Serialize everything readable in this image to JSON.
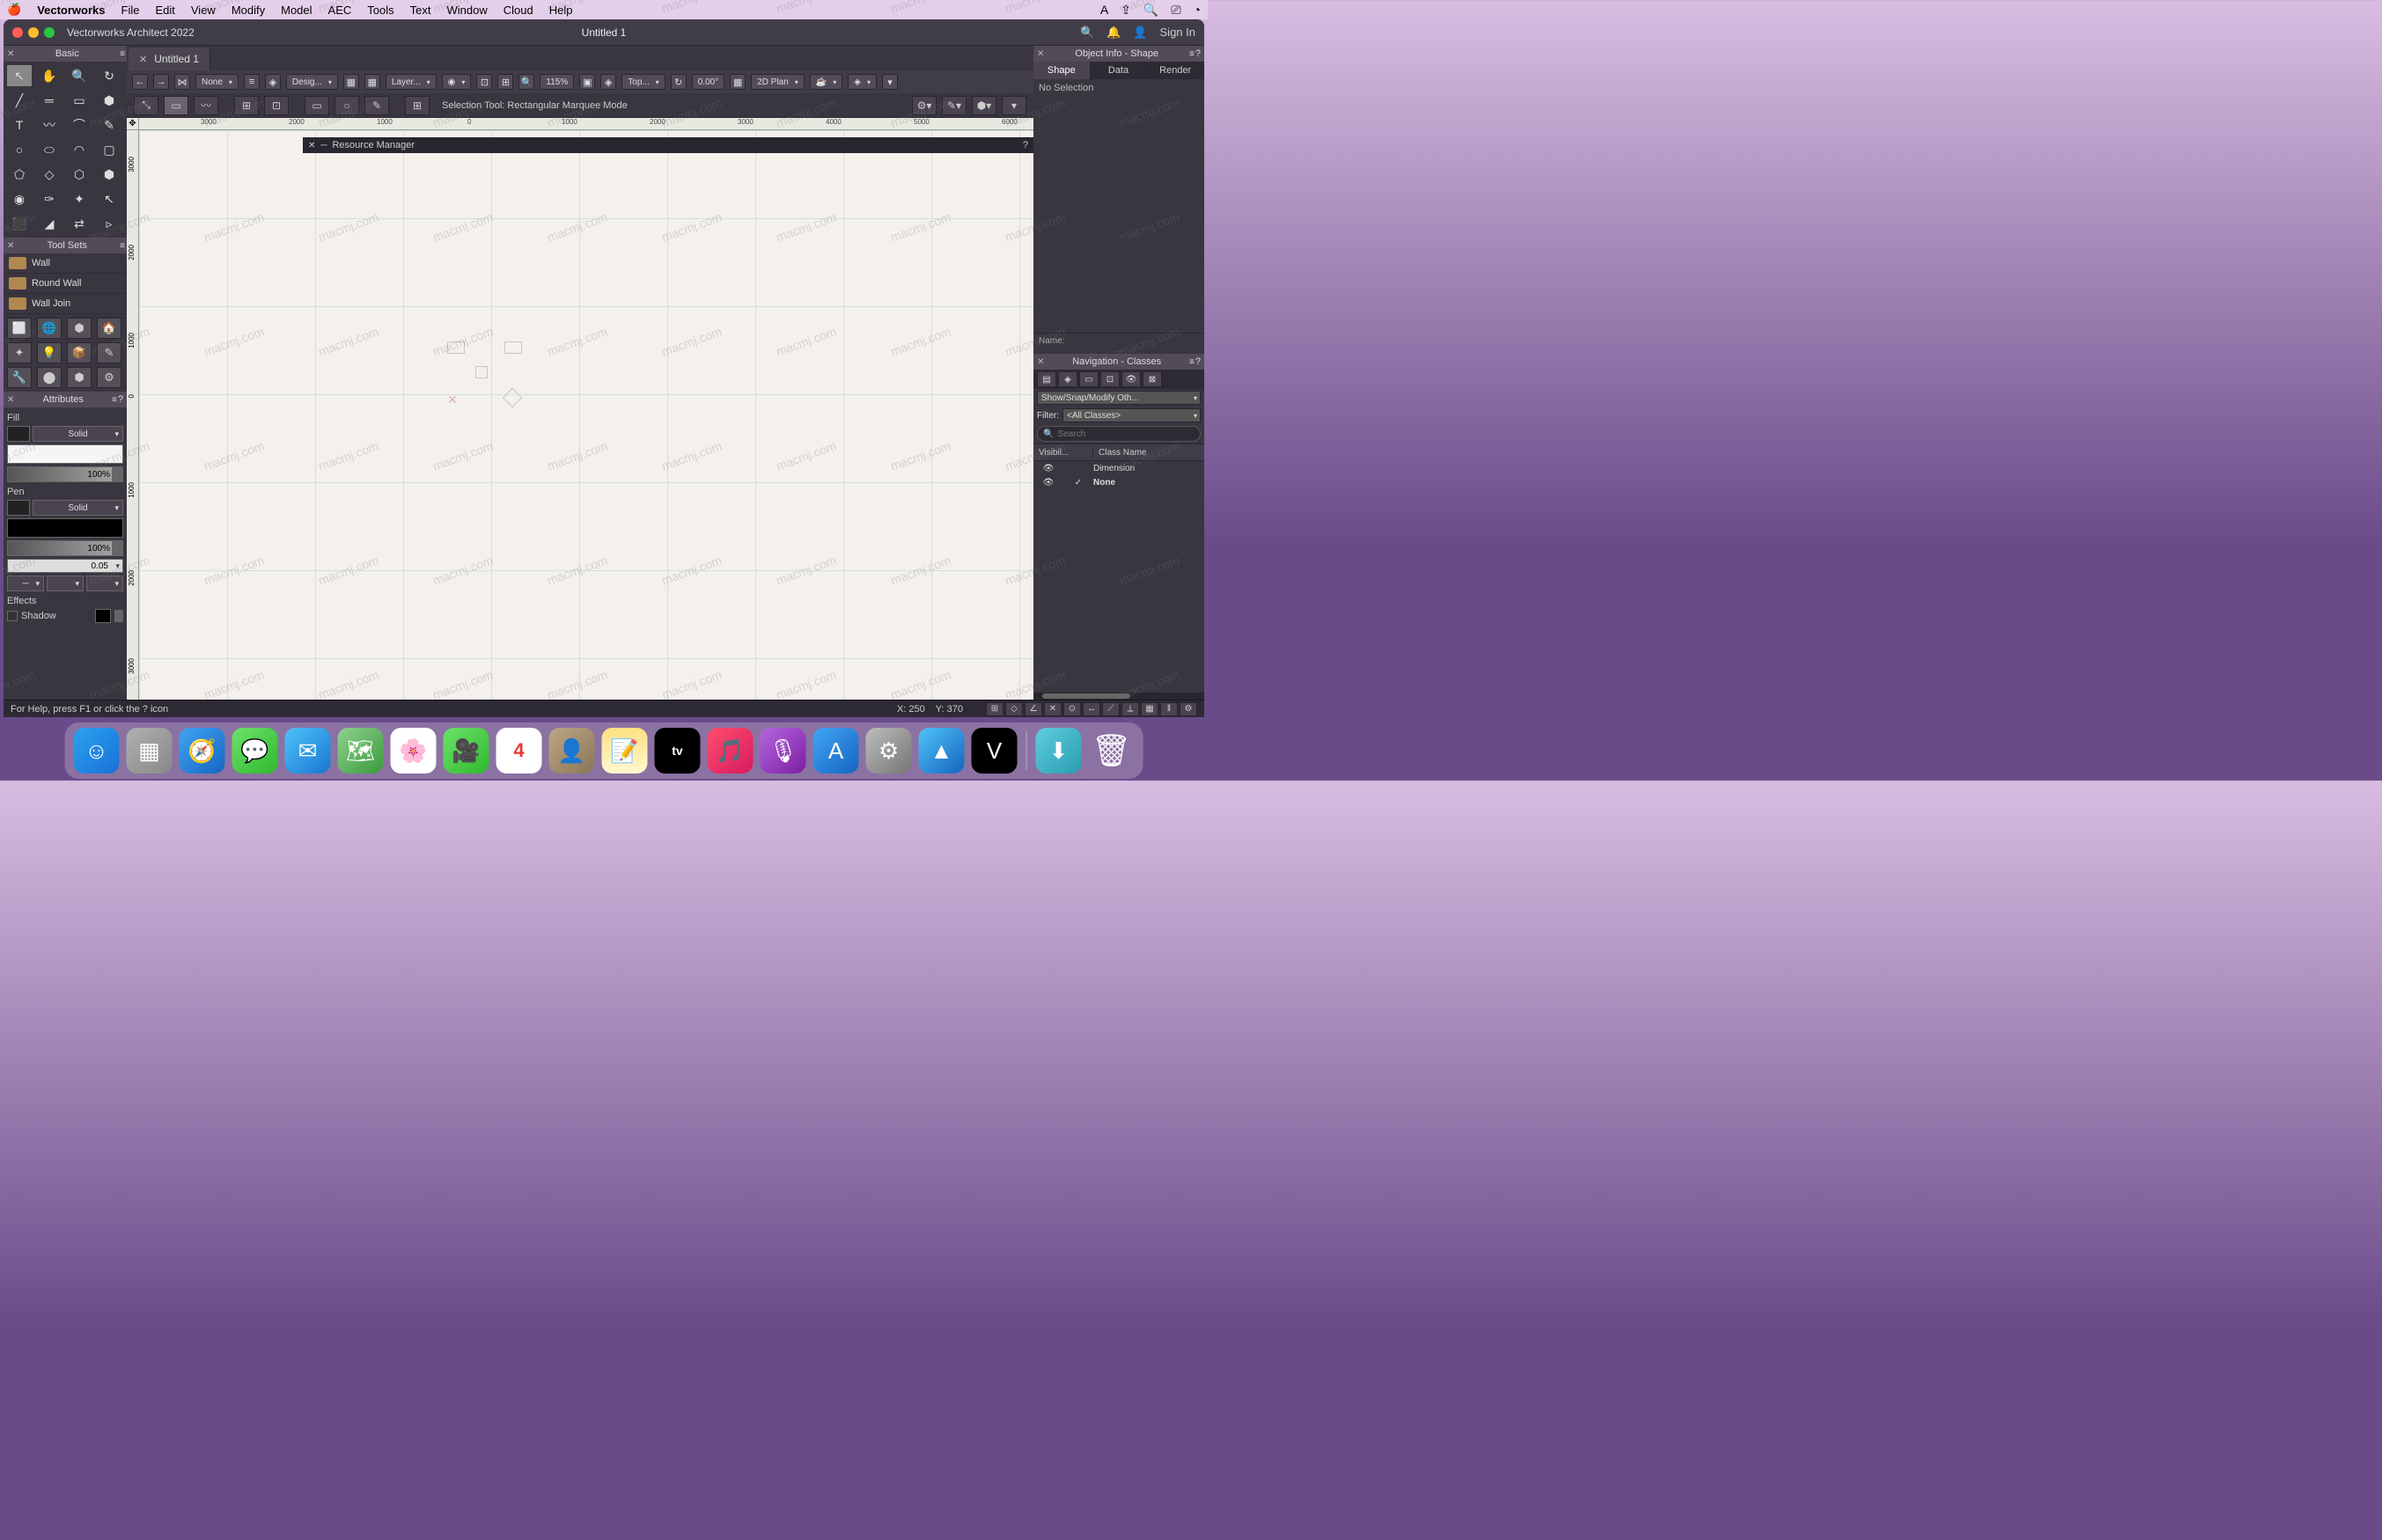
{
  "menubar": {
    "app": "Vectorworks",
    "items": [
      "File",
      "Edit",
      "View",
      "Modify",
      "Model",
      "AEC",
      "Tools",
      "Text",
      "Window",
      "Cloud",
      "Help"
    ]
  },
  "titlebar": {
    "app_title": "Vectorworks Architect 2022",
    "doc_title": "Untitled 1",
    "signin": "Sign In"
  },
  "tabs": {
    "doc_tab": "Untitled 1"
  },
  "viewbar": {
    "class_sel": "None",
    "layer_sel": "Desig...",
    "workplane": "Layer...",
    "zoom": "115%",
    "view": "Top...",
    "rotation": "0.00°",
    "render": "2D Plan"
  },
  "modebar": {
    "hint": "Selection Tool: Rectangular Marquee Mode"
  },
  "palettes": {
    "basic": {
      "title": "Basic"
    },
    "toolsets": {
      "title": "Tool Sets",
      "items": [
        "Wall",
        "Round Wall",
        "Wall Join"
      ]
    },
    "attributes": {
      "title": "Attributes",
      "fill_label": "Fill",
      "fill_type": "Solid",
      "fill_opacity": "100%",
      "pen_label": "Pen",
      "pen_type": "Solid",
      "pen_opacity": "100%",
      "line_weight": "0.05",
      "effects_label": "Effects",
      "shadow_label": "Shadow"
    }
  },
  "object_info": {
    "title": "Object Info - Shape",
    "tabs": [
      "Shape",
      "Data",
      "Render"
    ],
    "no_selection": "No Selection",
    "name_label": "Name:"
  },
  "navigation": {
    "title": "Navigation - Classes",
    "show_snap": "Show/Snap/Modify Oth...",
    "filter_label": "Filter:",
    "filter_value": "<All Classes>",
    "search_placeholder": "Search",
    "columns": {
      "visibility": "Visibil...",
      "class_name": "Class Name"
    },
    "rows": [
      {
        "visible": "👁",
        "active": "",
        "name": "Dimension"
      },
      {
        "visible": "👁",
        "active": "✓",
        "name": "None"
      }
    ]
  },
  "resource_manager": {
    "title": "Resource Manager"
  },
  "ruler": {
    "h_ticks": [
      "3000",
      "2000",
      "1000",
      "0",
      "1000",
      "2000",
      "3000",
      "4000",
      "5000",
      "6000"
    ],
    "v_ticks": [
      "3000",
      "2000",
      "1000",
      "0",
      "1000",
      "2000",
      "3000"
    ]
  },
  "statusbar": {
    "help": "For Help, press F1 or click the ? icon",
    "x_label": "X:",
    "x_val": "250",
    "y_label": "Y:",
    "y_val": "370"
  },
  "dock": {
    "apps": [
      {
        "name": "finder",
        "bg": "linear-gradient(135deg,#2aa3ef,#1a6fd8)",
        "glyph": "☺"
      },
      {
        "name": "launchpad",
        "bg": "linear-gradient(135deg,#b0b0b0,#888)",
        "glyph": "▦"
      },
      {
        "name": "safari",
        "bg": "linear-gradient(135deg,#42a5f5,#1565c0)",
        "glyph": "🧭"
      },
      {
        "name": "messages",
        "bg": "linear-gradient(135deg,#6ee36a,#2eb82e)",
        "glyph": "💬"
      },
      {
        "name": "mail",
        "bg": "linear-gradient(135deg,#4fc3f7,#1976d2)",
        "glyph": "✉"
      },
      {
        "name": "maps",
        "bg": "linear-gradient(135deg,#8fd28f,#3a9a3a)",
        "glyph": "🗺"
      },
      {
        "name": "photos",
        "bg": "#fff",
        "glyph": "🌸"
      },
      {
        "name": "facetime",
        "bg": "linear-gradient(135deg,#6ee36a,#2eb82e)",
        "glyph": "🎥"
      },
      {
        "name": "calendar",
        "bg": "#fff",
        "glyph": "4"
      },
      {
        "name": "contacts",
        "bg": "linear-gradient(135deg,#bca784,#8a7658)",
        "glyph": "👤"
      },
      {
        "name": "notes",
        "bg": "linear-gradient(180deg,#ffe082,#fff8d0)",
        "glyph": "📝"
      },
      {
        "name": "appletv",
        "bg": "#000",
        "glyph": "tv"
      },
      {
        "name": "music",
        "bg": "linear-gradient(135deg,#ff4d6d,#d81b60)",
        "glyph": "🎵"
      },
      {
        "name": "podcasts",
        "bg": "linear-gradient(135deg,#b565e0,#7b1fa2)",
        "glyph": "🎙"
      },
      {
        "name": "appstore",
        "bg": "linear-gradient(135deg,#42a5f5,#1565c0)",
        "glyph": "A"
      },
      {
        "name": "settings",
        "bg": "linear-gradient(135deg,#bdbdbd,#757575)",
        "glyph": "⚙"
      },
      {
        "name": "xcode",
        "bg": "linear-gradient(135deg,#4fc3f7,#1565c0)",
        "glyph": "▲"
      },
      {
        "name": "vectorworks",
        "bg": "#000",
        "glyph": "V"
      }
    ],
    "right_apps": [
      {
        "name": "downloads",
        "bg": "linear-gradient(135deg,#5ecde0,#2a9db0)",
        "glyph": "⬇"
      },
      {
        "name": "trash",
        "bg": "transparent",
        "glyph": "🗑"
      }
    ]
  },
  "watermark": "macmj.com"
}
